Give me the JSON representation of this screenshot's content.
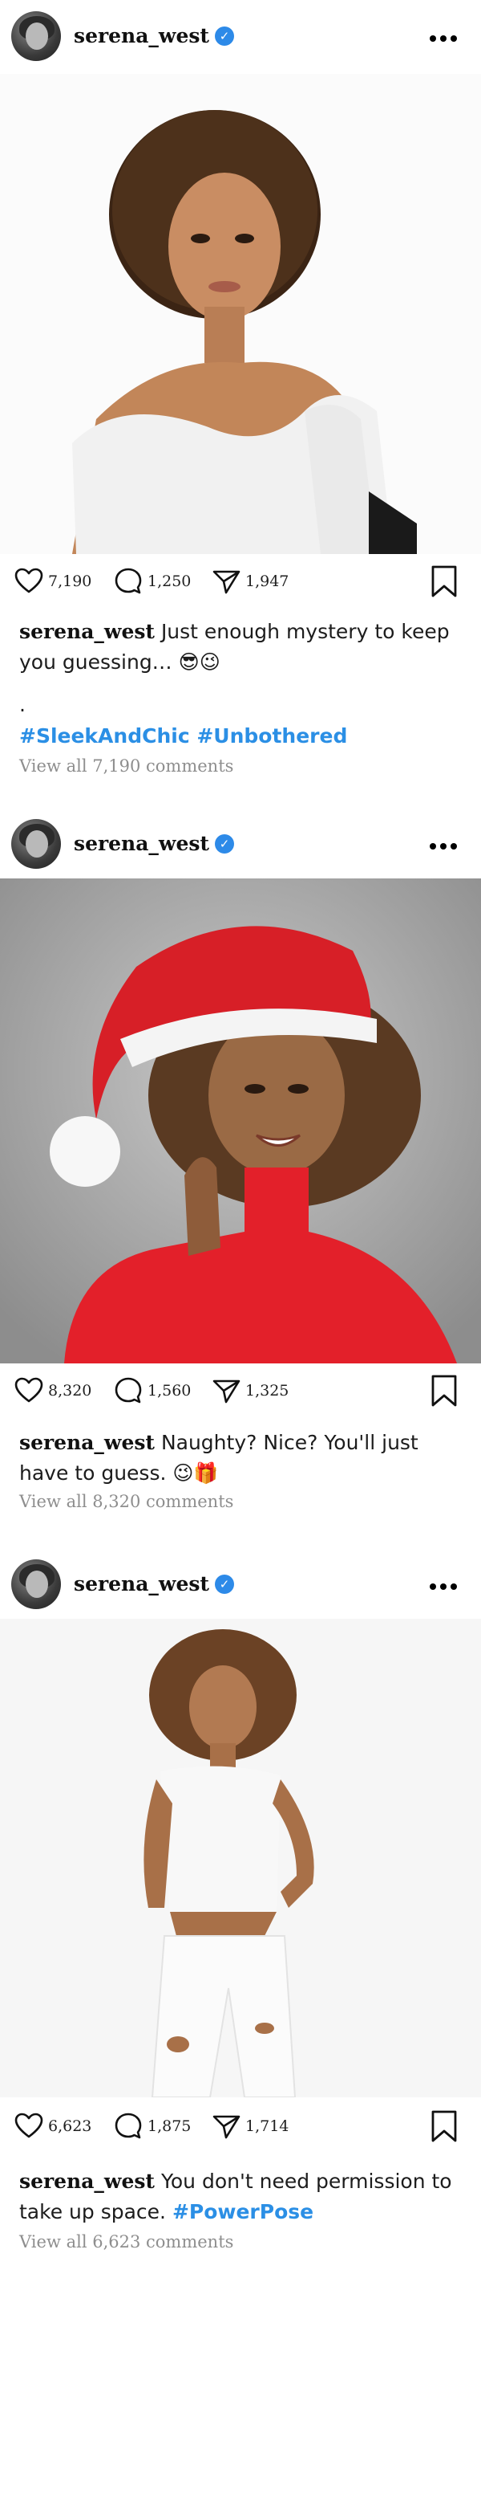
{
  "colors": {
    "accent": "#2b8fe5",
    "verified": "#2d8ae8",
    "muted": "#8e8e8e"
  },
  "icons": {
    "like": "heart-icon",
    "comment": "comment-icon",
    "share": "send-icon",
    "save": "bookmark-icon",
    "more": "more-dots-icon",
    "verified": "verified-badge-icon"
  },
  "posts": [
    {
      "username": "serena_west",
      "likes": "7,190",
      "comments": "1,250",
      "shares": "1,947",
      "caption_user": "serena_west",
      "caption_text": "Just enough mystery to keep you guessing… 😎😉",
      "caption_dot": ".",
      "hashtags": "#SleekAndChic #Unbothered",
      "view_all": "View all 7,190 comments"
    },
    {
      "username": "serena_west",
      "likes": "8,320",
      "comments": "1,560",
      "shares": "1,325",
      "caption_user": "serena_west",
      "caption_text": "Naughty? Nice? You'll just have to guess. 😉🎁",
      "view_all": "View all 8,320 comments"
    },
    {
      "username": "serena_west",
      "likes": "6,623",
      "comments": "1,875",
      "shares": "1,714",
      "caption_user": "serena_west",
      "caption_text": "You don't need permission to take up space.",
      "hashtags": "#PowerPose",
      "view_all": "View all 6,623 comments"
    }
  ]
}
